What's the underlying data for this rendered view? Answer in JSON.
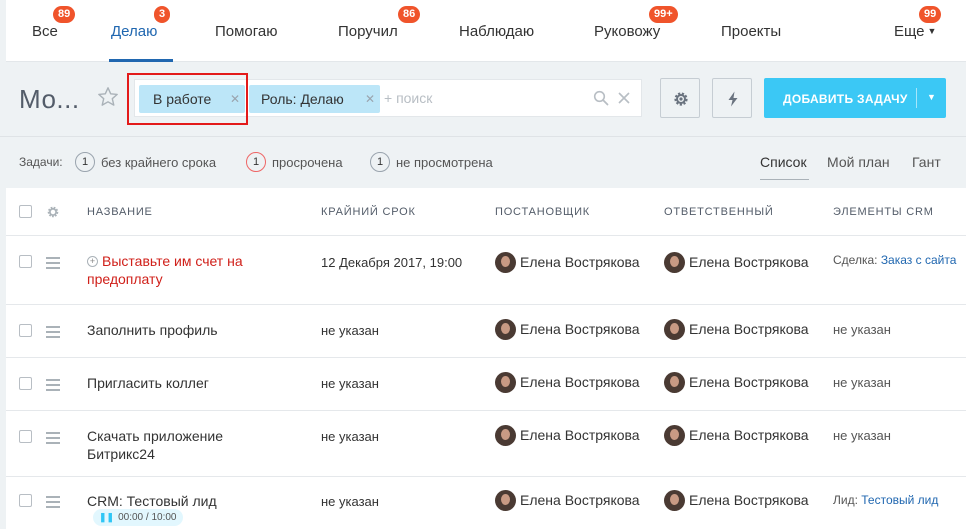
{
  "tabs": [
    {
      "label": "Все",
      "badge": "89"
    },
    {
      "label": "Делаю",
      "badge": "3"
    },
    {
      "label": "Помогаю",
      "badge": ""
    },
    {
      "label": "Поручил",
      "badge": "86"
    },
    {
      "label": "Наблюдаю",
      "badge": ""
    },
    {
      "label": "Руковожу",
      "badge": "99+"
    },
    {
      "label": "Проекты",
      "badge": ""
    },
    {
      "label": "Еще",
      "badge": "99"
    }
  ],
  "page_title": "Мо...",
  "filter": {
    "chips": [
      "В работе",
      "Роль: Делаю"
    ],
    "search_placeholder": "+ поиск"
  },
  "toolbar": {
    "add_task_label": "ДОБАВИТЬ ЗАДАЧУ"
  },
  "counters": {
    "label": "Задачи:",
    "items": [
      {
        "count": "1",
        "label": "без крайнего срока"
      },
      {
        "count": "1",
        "label": "просрочена"
      },
      {
        "count": "1",
        "label": "не просмотрена"
      }
    ]
  },
  "views": [
    "Список",
    "Мой план",
    "Гант"
  ],
  "columns": [
    "НАЗВАНИЕ",
    "КРАЙНИЙ СРОК",
    "ПОСТАНОВЩИК",
    "ОТВЕТСТВЕННЫЙ",
    "ЭЛЕМЕНТЫ CRM"
  ],
  "rows": [
    {
      "title": "Выставьте им счет на предоплату",
      "deadline": "12 Декабря 2017, 19:00",
      "creator": "Елена Вострякова",
      "responsible": "Елена Вострякова",
      "crm_prefix": "Сделка:",
      "crm_link": "Заказ с сайта"
    },
    {
      "title": "Заполнить профиль",
      "deadline": "не указан",
      "creator": "Елена Вострякова",
      "responsible": "Елена Вострякова",
      "crm_prefix": "не указан",
      "crm_link": ""
    },
    {
      "title": "Пригласить коллег",
      "deadline": "не указан",
      "creator": "Елена Вострякова",
      "responsible": "Елена Вострякова",
      "crm_prefix": "не указан",
      "crm_link": ""
    },
    {
      "title": "Скачать приложение Битрикс24",
      "deadline": "не указан",
      "creator": "Елена Вострякова",
      "responsible": "Елена Вострякова",
      "crm_prefix": "не указан",
      "crm_link": ""
    },
    {
      "title": "CRM: Тестовый лид",
      "deadline": "не указан",
      "creator": "Елена Вострякова",
      "responsible": "Елена Вострякова",
      "crm_prefix": "Лид:",
      "crm_link": "Тестовый лид",
      "timer": "00:00 / 10:00"
    }
  ],
  "colors": {
    "accent": "#2067b0",
    "badge": "#f0542b",
    "add_button": "#3bc8f5",
    "chip": "#bce6f8",
    "highlight": "#e31a1a",
    "overdue": "#d0201a"
  }
}
